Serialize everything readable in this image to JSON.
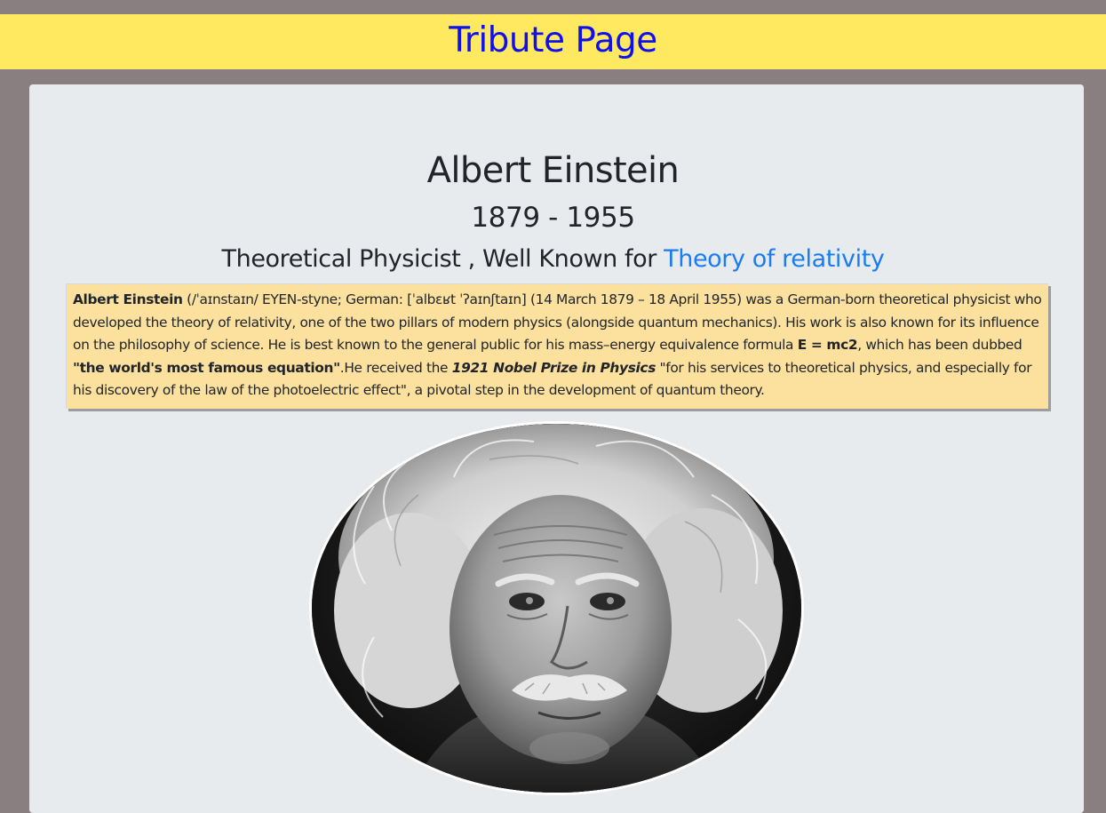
{
  "header": {
    "title": "Tribute Page"
  },
  "main": {
    "name": "Albert Einstein",
    "years": "1879 - 1955",
    "subtitle_prefix": "Theoretical Physicist , Well Known for ",
    "subtitle_link": "Theory of relativity",
    "bio": {
      "name_bold": "Albert Einstein",
      "part1": " (/ˈaɪnstaɪn/ EYEN-styne; German: [ˈalbɛʁt ˈʔaɪnʃtaɪn] (14 March 1879 – 18 April 1955) was a German-born theoretical physicist who developed the theory of relativity, one of the two pillars of modern physics (alongside quantum mechanics). His work is also known for its influence on the philosophy of science. He is best known to the general public for his mass–energy equivalence formula ",
      "formula_bold": "E = mc2",
      "part2": ", which has been dubbed ",
      "quote_bold": "\"the world's most famous equation\"",
      "part3": ".He received the ",
      "prize_bold_italic": "1921 Nobel Prize in Physics",
      "part4": " \"for his services to theoretical physics, and especially for his discovery of the law of the photoelectric effect\", a pivotal step in the development of quantum theory."
    },
    "portrait_icon": "einstein-portrait-image"
  },
  "colors": {
    "page_bg": "#8a7f80",
    "banner_bg": "#ffe960",
    "banner_text": "#1010ee",
    "card_bg": "#e8ebee",
    "link": "#1a7cf0",
    "bio_bg": "#fbe09e"
  }
}
